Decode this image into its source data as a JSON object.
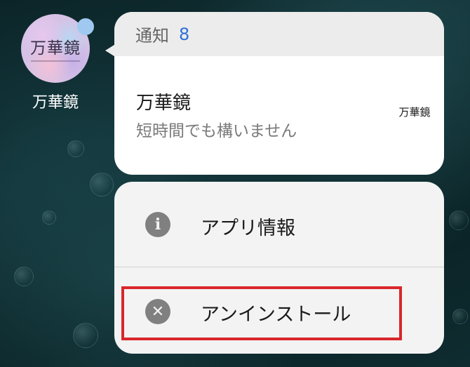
{
  "app": {
    "name": "万華鏡",
    "icon_logo_text": "万華鏡",
    "badge_color": "#9fc9f1"
  },
  "notification": {
    "header_label": "通知",
    "count": "8",
    "title": "万華鏡",
    "text": "短時間でも構いません",
    "thumbnail_text": "万華鏡"
  },
  "menu": {
    "items": [
      {
        "label": "アプリ情報",
        "icon": "info-icon"
      },
      {
        "label": "アンインストール",
        "icon": "close-circle-icon"
      }
    ]
  },
  "colors": {
    "count_blue": "#2f6fd6",
    "highlight_red": "#d9262b"
  }
}
